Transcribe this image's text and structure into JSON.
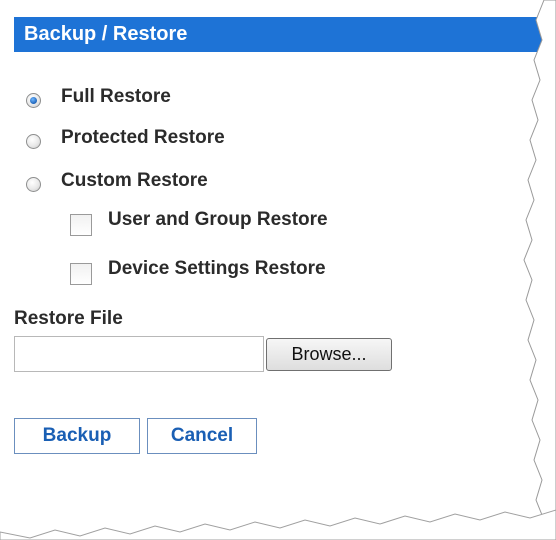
{
  "header": {
    "title": "Backup / Restore"
  },
  "options": [
    {
      "label": "Full Restore",
      "checked": true
    },
    {
      "label": "Protected Restore",
      "checked": false
    },
    {
      "label": "Custom Restore",
      "checked": false
    }
  ],
  "custom_options": [
    {
      "label": "User and Group Restore",
      "checked": false
    },
    {
      "label": "Device Settings Restore",
      "checked": false
    }
  ],
  "restore_file": {
    "label": "Restore File",
    "value": "",
    "browse_label": "Browse..."
  },
  "actions": {
    "backup_label": "Backup",
    "cancel_label": "Cancel"
  },
  "colors": {
    "header_bg": "#1e73d6",
    "button_text": "#1a5fb4"
  }
}
